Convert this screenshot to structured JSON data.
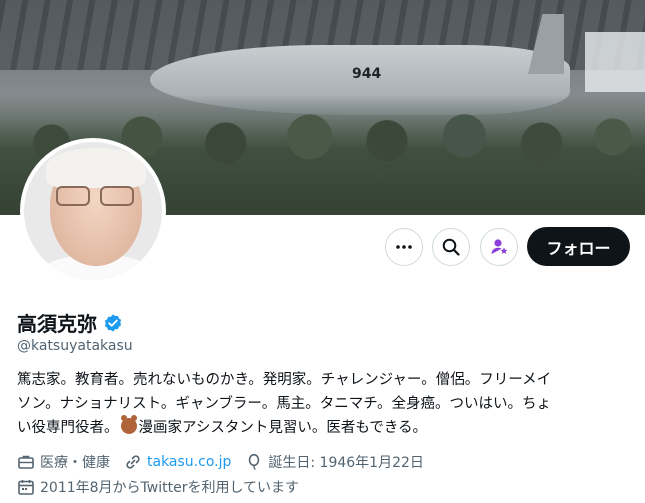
{
  "profile": {
    "display_name": "高須克弥",
    "handle": "@katsuyatakasu",
    "verified": true,
    "banner_text": "944",
    "bio_lines": [
      "篤志家。教育者。売れないものかき。発明家。チャレンジャー。僧侶。フリーメイ",
      "ソン。ナショナリスト。ギャンブラー。馬主。タニマチ。全身癌。ついはい。ちょ",
      "い役専門役者。",
      "漫画家アシスタント見習い。医者もできる。"
    ],
    "category": "医療・健康",
    "website": "takasu.co.jp",
    "birthday": "誕生日: 1946年1月22日",
    "joined": "2011年8月からTwitterを利用しています"
  },
  "actions": {
    "more_icon": "more-dots-icon",
    "search_icon": "search-icon",
    "subscribe_icon": "person-star-icon",
    "follow_label": "フォロー"
  },
  "colors": {
    "accent": "#1d9bf0",
    "subscribe": "#8b3fd9",
    "text": "#0f1419",
    "muted": "#536471"
  }
}
